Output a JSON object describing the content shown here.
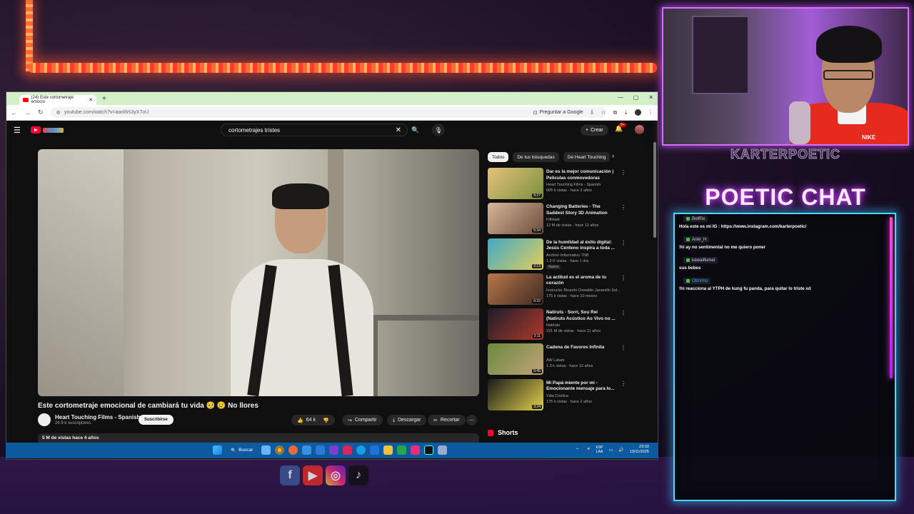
{
  "browser": {
    "tab_title": "(24) Este cortometraje emocio",
    "url": "youtube.com/watch?v=aaoWs3yX7oU",
    "ask_google": "Preguntar a Google"
  },
  "youtube": {
    "search_query": "cortometrajes tristes",
    "create_label": "Crear",
    "notif_count": "9+",
    "video": {
      "title": "Este cortometraje emocional de cambiará tu vida 🥺 😢 No llores",
      "channel": "Heart Touching Films - Spanish",
      "subscribers": "24.9 k suscriptores",
      "subscribe_label": "Suscribirse",
      "likes": "64 k",
      "share_label": "Compartir",
      "download_label": "Descargar",
      "clip_label": "Recortar",
      "views_meta": "5 M de vistas  hace 4 años"
    },
    "chips": [
      "Todos",
      "De tus búsquedas",
      "De Heart Touching"
    ],
    "recommendations": [
      {
        "title": "Dar es la mejor comunicación | Películas conmovedoras",
        "channel": "Heart Touching Films - Spanish",
        "meta": "605 k vistas · hace 3 años",
        "duration": "9:27",
        "badge": ""
      },
      {
        "title": "Changing Batteries - The Saddest Story 3D Animation",
        "channel": "FifiHadi",
        "meta": "12 M de vistas · hace 12 años",
        "duration": "5:34",
        "badge": ""
      },
      {
        "title": "De la humildad al éxito digital: Jesús Centeno inspira a toda ...",
        "channel": "Archivo Informativo TNB",
        "meta": "1.2 K vistas · hace 1 día",
        "duration": "2:13",
        "badge": "Nuevo"
      },
      {
        "title": "La actitud es el aroma de tu corazón",
        "channel": "Instructor Ricardo Oswaldo Jaramillo Sol...",
        "meta": "175 k vistas · hace 10 meses",
        "duration": "6:22",
        "badge": ""
      },
      {
        "title": "Natiruts - Sorri, Sou Rei (Natiruts Acústico Ao Vivo no ...",
        "channel": "Natiruts",
        "meta": "231 M de vistas · hace 11 años",
        "duration": "3:11",
        "badge": ""
      },
      {
        "title": "Cadena de Favores Infinita",
        "channel": "AW Latam",
        "meta": "1.3 k vistas · hace 12 años",
        "duration": "5:45",
        "badge": ""
      },
      {
        "title": "Mi Papá miente por mí - Emocionante mensaje para lo...",
        "channel": "Vida Cristica",
        "meta": "175 k vistas · hace 2 años",
        "duration": "3:24",
        "badge": ""
      }
    ],
    "shorts_label": "Shorts"
  },
  "taskbar": {
    "search_label": "Buscar",
    "lang_top": "ESP",
    "lang_bottom": "LAA",
    "time": "23:03",
    "date": "13/11/2025"
  },
  "overlay": {
    "streamer": "KARTERPOETIC",
    "chat_title": "POETIC CHAT",
    "jacket_brand": "NIKE"
  },
  "chat": {
    "messages": [
      {
        "user": "BotRix",
        "text": "Hola este es mi IG : https://www.instagram.com/karterpoetic/"
      },
      {
        "user": "Ariel_H",
        "text": "!hi ay no sentimental no me quiero poner"
      },
      {
        "user": "kawaiifumei",
        "text": "sus bebes"
      },
      {
        "user": "Olizinho",
        "text": "!hi reacciona al YTPH de kung fu panda, para quitar lo triste xd"
      }
    ]
  },
  "colors": {
    "yt_red": "#ff0033",
    "chat_border": "#4ad8ff",
    "neon_pink": "#e04bff",
    "taskbar": "#0d5aa0"
  }
}
